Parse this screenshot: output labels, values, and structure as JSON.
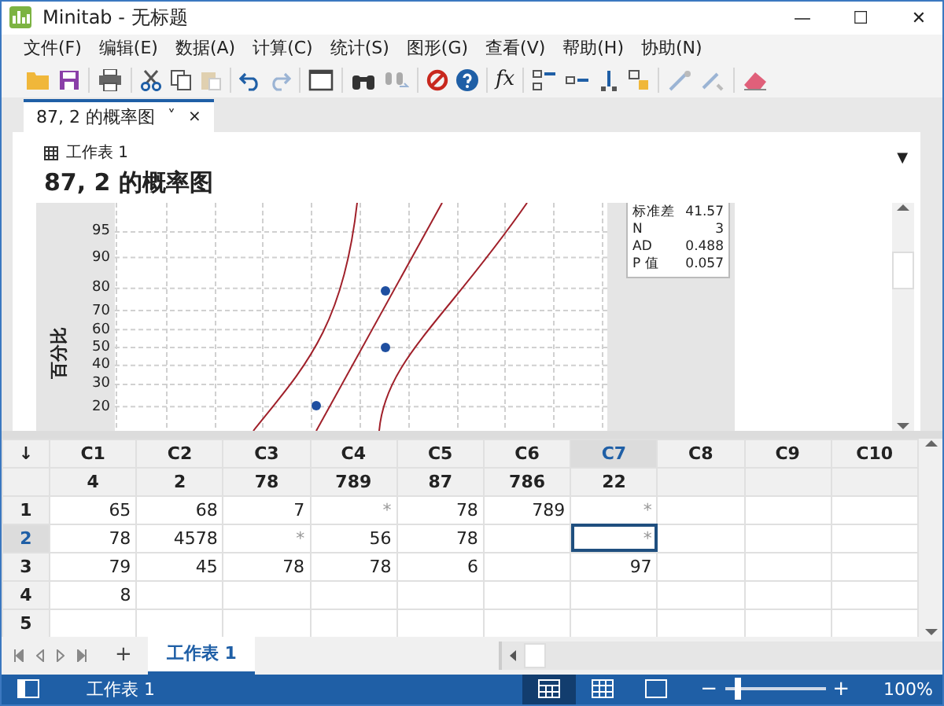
{
  "window": {
    "title": "Minitab - 无标题",
    "controls": [
      "—",
      "☐",
      "✕"
    ]
  },
  "menu": [
    {
      "label": "文件(F)"
    },
    {
      "label": "编辑(E)"
    },
    {
      "label": "数据(A)"
    },
    {
      "label": "计算(C)"
    },
    {
      "label": "统计(S)"
    },
    {
      "label": "图形(G)"
    },
    {
      "label": "查看(V)"
    },
    {
      "label": "帮助(H)"
    },
    {
      "label": "协助(N)"
    }
  ],
  "toolbar": {
    "formula_label": "fx",
    "buttons": [
      {
        "disabled": false
      },
      {
        "disabled": false
      },
      {
        "disabled": false
      },
      {
        "disabled": false
      },
      {
        "disabled": false
      },
      {
        "disabled": true
      },
      {
        "disabled": false
      },
      {
        "disabled": true
      },
      {
        "disabled": false
      },
      {
        "disabled": false
      },
      {
        "disabled": true
      },
      {
        "disabled": false
      },
      {
        "disabled": false
      },
      {
        "disabled": false
      },
      {
        "disabled": false
      },
      {
        "disabled": false
      },
      {
        "disabled": false
      },
      {
        "disabled": true
      },
      {
        "disabled": true
      },
      {
        "disabled": false
      }
    ]
  },
  "document_tabs": [
    {
      "label": "87, 2 的概率图",
      "dropdown": "˅",
      "close": "×",
      "selected": true
    }
  ],
  "output": {
    "worksheet": "工作表 1",
    "title": "87, 2 的概率图",
    "dropdown": "▼",
    "chart": {
      "ylabel": "百分比",
      "y_tick_labels": [
        "95",
        "90",
        "80",
        "70",
        "60",
        "50",
        "40",
        "30",
        "20"
      ],
      "stats": [
        {
          "label": "标准差",
          "value": "41.57"
        },
        {
          "label": "N",
          "value": "3"
        },
        {
          "label": "AD",
          "value": "0.488"
        },
        {
          "label": "P 值",
          "value": "0.057"
        }
      ]
    }
  },
  "worksheet": {
    "corner": "↓",
    "columns": [
      {
        "label": "C1",
        "name": "4",
        "selected": false
      },
      {
        "label": "C2",
        "name": "2",
        "selected": false
      },
      {
        "label": "C3",
        "name": "78",
        "selected": false
      },
      {
        "label": "C4",
        "name": "789",
        "selected": false
      },
      {
        "label": "C5",
        "name": "87",
        "selected": false
      },
      {
        "label": "C6",
        "name": "786",
        "selected": false
      },
      {
        "label": "C7",
        "name": "22",
        "selected": true
      },
      {
        "label": "C8",
        "selected": false
      },
      {
        "label": "C9",
        "selected": false
      },
      {
        "label": "C10",
        "selected": false
      }
    ],
    "rows": [
      {
        "label": "1",
        "selected": false,
        "cells": [
          {
            "value": "65",
            "selected": false
          },
          {
            "value": "68",
            "selected": false
          },
          {
            "value": "7",
            "selected": false
          },
          {
            "value": "*",
            "selected": false
          },
          {
            "value": "78",
            "selected": false
          },
          {
            "value": "789",
            "selected": false
          },
          {
            "value": "*",
            "selected": false
          },
          {
            "selected": false
          },
          {
            "selected": false
          },
          {
            "selected": false
          }
        ]
      },
      {
        "label": "2",
        "selected": true,
        "cells": [
          {
            "value": "78",
            "selected": false
          },
          {
            "value": "4578",
            "selected": false
          },
          {
            "value": "*",
            "selected": false
          },
          {
            "value": "56",
            "selected": false
          },
          {
            "value": "78",
            "selected": false
          },
          {
            "selected": false
          },
          {
            "value": "*",
            "selected": true
          },
          {
            "selected": false
          },
          {
            "selected": false
          },
          {
            "selected": false
          }
        ]
      },
      {
        "label": "3",
        "selected": false,
        "cells": [
          {
            "value": "79",
            "selected": false
          },
          {
            "value": "45",
            "selected": false
          },
          {
            "value": "78",
            "selected": false
          },
          {
            "value": "78",
            "selected": false
          },
          {
            "value": "6",
            "selected": false
          },
          {
            "selected": false
          },
          {
            "value": "97",
            "selected": false
          },
          {
            "selected": false
          },
          {
            "selected": false
          },
          {
            "selected": false
          }
        ]
      },
      {
        "label": "4",
        "selected": false,
        "cells": [
          {
            "value": "8",
            "selected": false
          },
          {
            "selected": false
          },
          {
            "selected": false
          },
          {
            "selected": false
          },
          {
            "selected": false
          },
          {
            "selected": false
          },
          {
            "selected": false
          },
          {
            "selected": false
          },
          {
            "selected": false
          },
          {
            "selected": false
          }
        ]
      },
      {
        "label": "5",
        "selected": false,
        "cells": [
          {
            "selected": false
          },
          {
            "selected": false
          },
          {
            "selected": false
          },
          {
            "selected": false
          },
          {
            "selected": false
          },
          {
            "selected": false
          },
          {
            "selected": false
          },
          {
            "selected": false
          },
          {
            "selected": false
          },
          {
            "selected": false
          }
        ]
      }
    ]
  },
  "sheet_tabs": {
    "add": "+",
    "tabs": [
      {
        "label": "工作表 1",
        "selected": true
      }
    ]
  },
  "status_bar": {
    "sheet": "工作表 1",
    "views": [
      {
        "selected": true
      },
      {
        "selected": false
      },
      {
        "selected": false
      }
    ],
    "zoom": {
      "minus": "−",
      "plus": "+",
      "level": 0.13,
      "reading": "100%"
    }
  }
}
